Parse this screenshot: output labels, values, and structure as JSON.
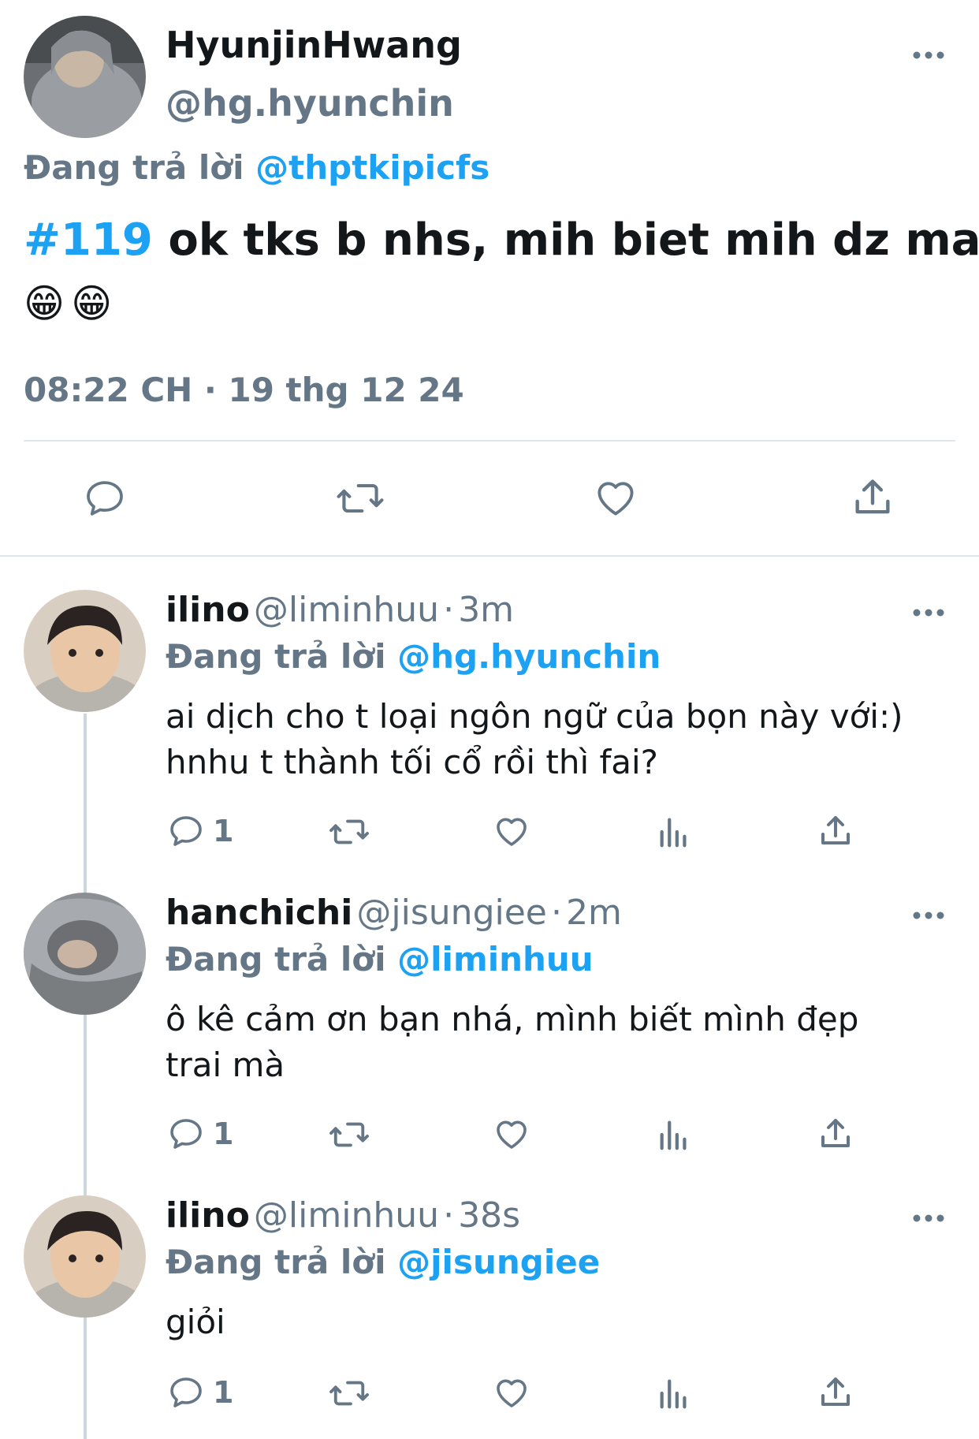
{
  "main_tweet": {
    "author_name": "HyunjinHwang",
    "author_handle": "@hg.hyunchin",
    "replying_label": "Đang trả lời",
    "replying_to": "@thptkipicfs",
    "hashtag": "#119",
    "text": "ok tks b nhs, mih biet mih dz ma",
    "emoji": "😁😁",
    "timestamp": "08:22 CH · 19 thg 12 24"
  },
  "replies": [
    {
      "name": "ilino",
      "handle": "@liminhuu",
      "time": "3m",
      "replying_label": "Đang trả lời",
      "replying_to": "@hg.hyunchin",
      "text": "ai dịch cho t loại ngôn ngữ của bọn này với:) hnhu t thành tối cổ rồi thì fai?",
      "reply_count": "1"
    },
    {
      "name": "hanchichi",
      "handle": "@jisungiee",
      "time": "2m",
      "replying_label": "Đang trả lời",
      "replying_to": "@liminhuu",
      "text": "ô kê cảm ơn bạn nhá, mình biết mình đẹp trai mà",
      "reply_count": "1"
    },
    {
      "name": "ilino",
      "handle": "@liminhuu",
      "time": "38s",
      "replying_label": "Đang trả lời",
      "replying_to": "@jisungiee",
      "text": "giỏi",
      "reply_count": "1"
    }
  ],
  "icons": {
    "reply": "reply-icon",
    "retweet": "retweet-icon",
    "like": "heart-icon",
    "share": "share-icon",
    "analytics": "analytics-icon",
    "more": "more-icon"
  },
  "colors": {
    "link": "#1da1f2",
    "muted": "#657786",
    "text": "#14171a"
  }
}
